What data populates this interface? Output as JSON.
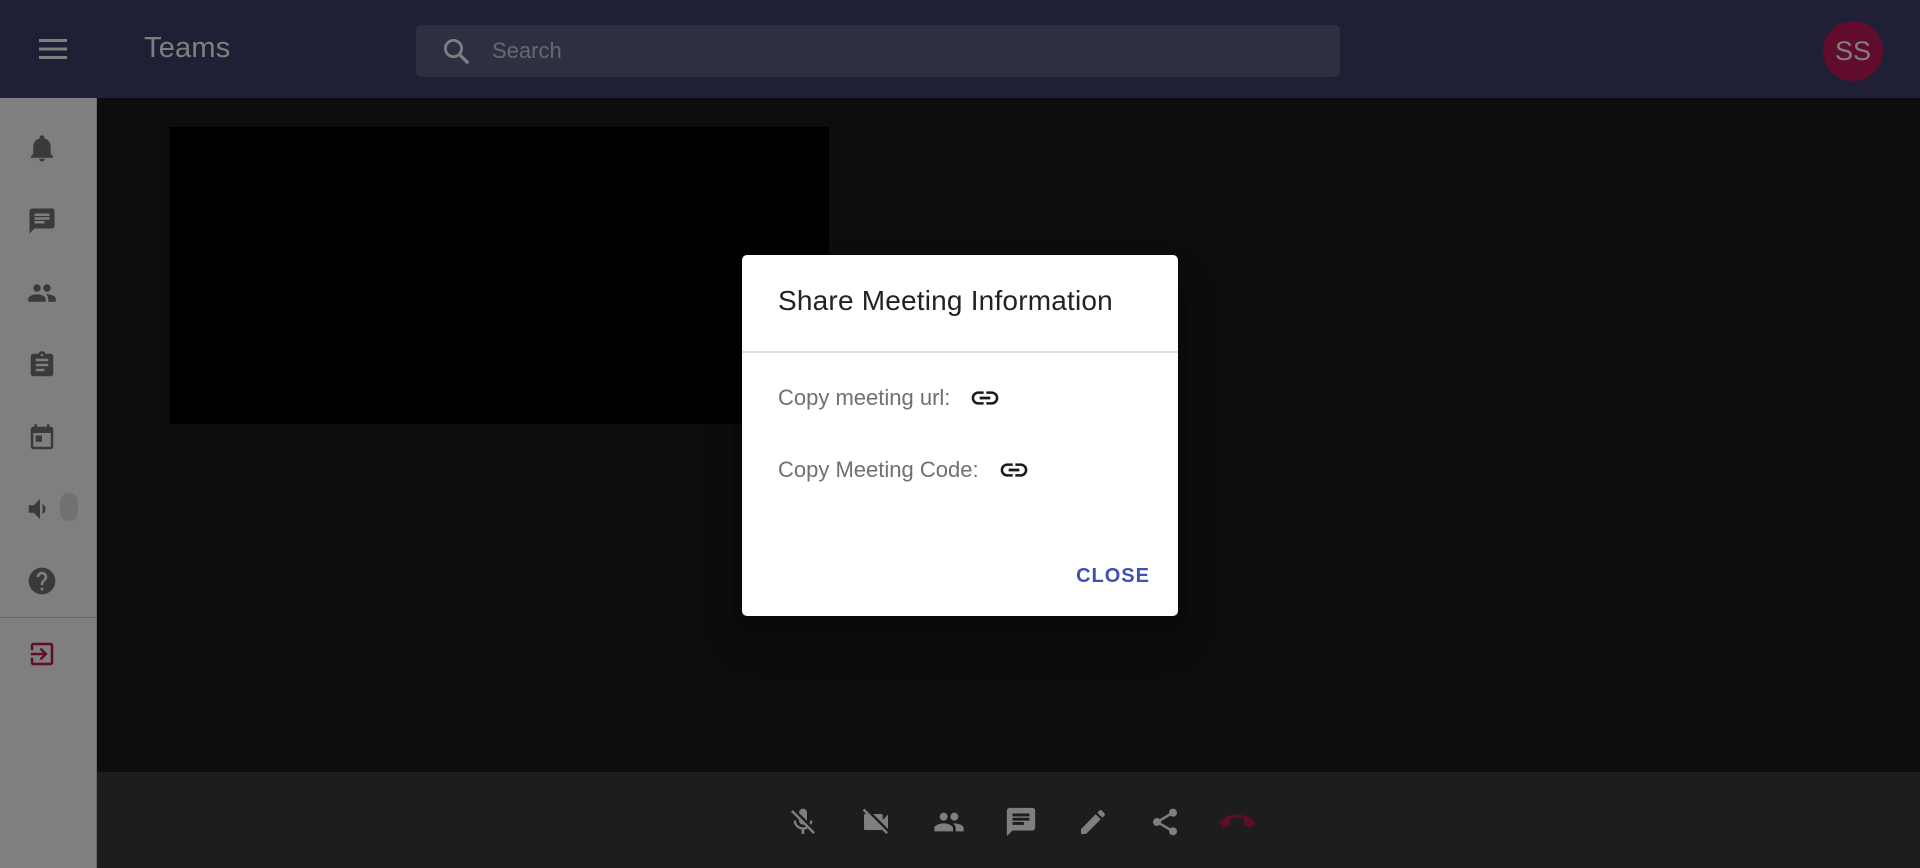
{
  "topbar": {
    "app_title": "Teams",
    "search_placeholder": "Search",
    "avatar_initials": "SS",
    "color": "#3f3f6c"
  },
  "sidebar": {
    "items": [
      {
        "name": "notifications",
        "icon": "bell-icon"
      },
      {
        "name": "chat",
        "icon": "chat-icon"
      },
      {
        "name": "teams",
        "icon": "people-icon"
      },
      {
        "name": "assignments",
        "icon": "clipboard-icon"
      },
      {
        "name": "calendar",
        "icon": "calendar-icon"
      },
      {
        "name": "volume",
        "icon": "volume-icon"
      },
      {
        "name": "help",
        "icon": "help-icon"
      },
      {
        "name": "logout",
        "icon": "logout-icon"
      }
    ]
  },
  "controls": {
    "items": [
      {
        "name": "mic-off",
        "icon": "mic-off-icon"
      },
      {
        "name": "video-off",
        "icon": "video-off-icon"
      },
      {
        "name": "participants",
        "icon": "people-icon"
      },
      {
        "name": "chat",
        "icon": "chat-icon"
      },
      {
        "name": "whiteboard",
        "icon": "pencil-icon"
      },
      {
        "name": "share",
        "icon": "share-icon"
      },
      {
        "name": "hang-up",
        "icon": "phone-hangup-icon"
      }
    ],
    "hangup_color": "#c2185b"
  },
  "dialog": {
    "title": "Share Meeting Information",
    "copy_url_label": "Copy meeting url:",
    "copy_code_label": "Copy Meeting Code:",
    "close_label": "CLOSE",
    "accent": "#3f51b5"
  }
}
